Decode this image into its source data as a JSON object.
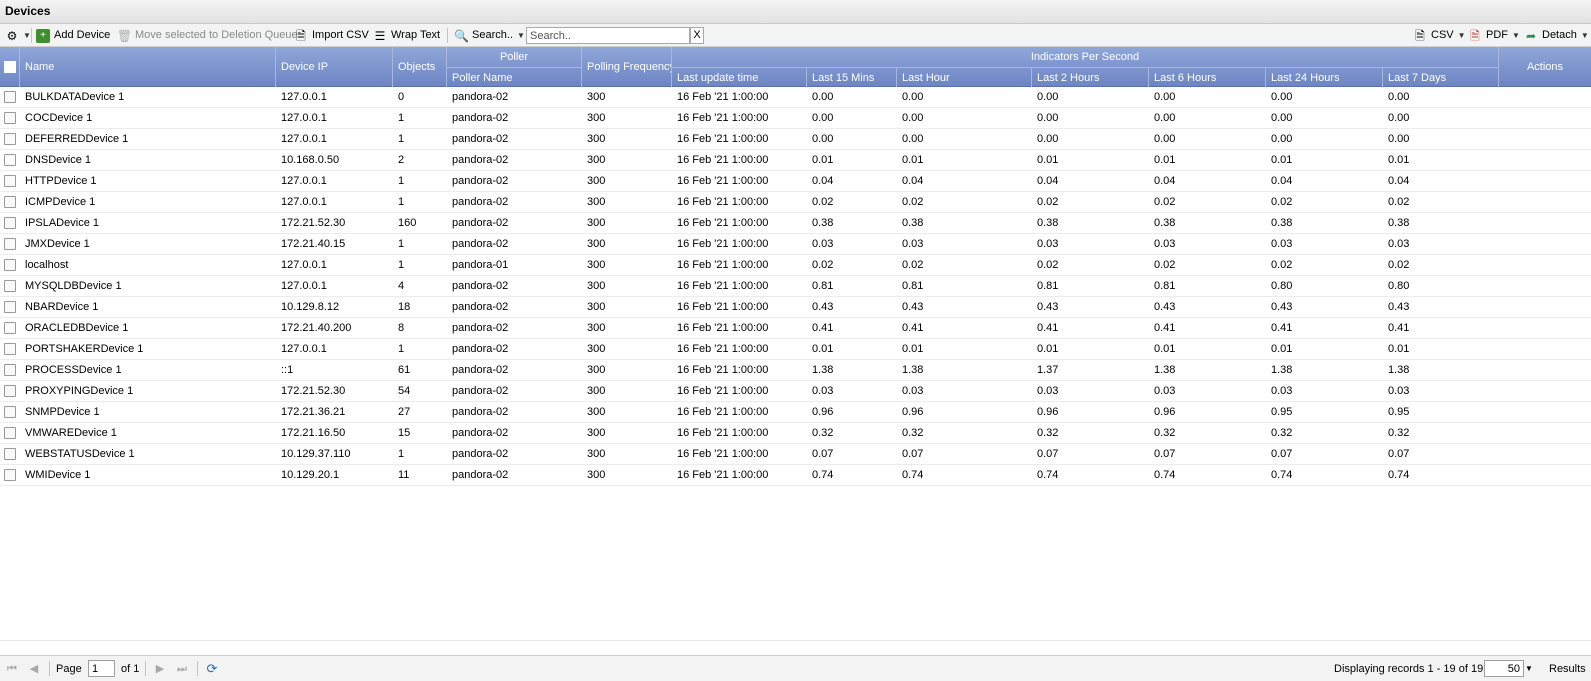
{
  "window": {
    "title": "Devices"
  },
  "toolbar": {
    "settings_icon": "gear-icon",
    "add_device": "Add Device",
    "move_to_deletion": "Move selected to Deletion Queue",
    "import_csv": "Import CSV",
    "wrap_text": "Wrap Text",
    "search_menu": "Search..",
    "search_placeholder": "Search..",
    "search_clear": "X",
    "csv": "CSV",
    "pdf": "PDF",
    "detach": "Detach"
  },
  "columns": {
    "name": "Name",
    "device_ip": "Device IP",
    "objects": "Objects",
    "poller_group": "Poller",
    "poller_name": "Poller Name",
    "polling_frequency": "Polling Frequency",
    "ips_group": "Indicators Per Second",
    "last_update": "Last update time",
    "last_15": "Last 15 Mins",
    "last_hour": "Last Hour",
    "last_2h": "Last 2 Hours",
    "last_6h": "Last 6 Hours",
    "last_24h": "Last 24 Hours",
    "last_7d": "Last 7 Days",
    "actions": "Actions"
  },
  "rows": [
    [
      "BULKDATADevice 1",
      "127.0.0.1",
      "0",
      "pandora-02",
      "300",
      "16 Feb '21 1:00:00",
      "0.00",
      "0.00",
      "0.00",
      "0.00",
      "0.00",
      "0.00"
    ],
    [
      "COCDevice 1",
      "127.0.0.1",
      "1",
      "pandora-02",
      "300",
      "16 Feb '21 1:00:00",
      "0.00",
      "0.00",
      "0.00",
      "0.00",
      "0.00",
      "0.00"
    ],
    [
      "DEFERREDDevice 1",
      "127.0.0.1",
      "1",
      "pandora-02",
      "300",
      "16 Feb '21 1:00:00",
      "0.00",
      "0.00",
      "0.00",
      "0.00",
      "0.00",
      "0.00"
    ],
    [
      "DNSDevice 1",
      "10.168.0.50",
      "2",
      "pandora-02",
      "300",
      "16 Feb '21 1:00:00",
      "0.01",
      "0.01",
      "0.01",
      "0.01",
      "0.01",
      "0.01"
    ],
    [
      "HTTPDevice 1",
      "127.0.0.1",
      "1",
      "pandora-02",
      "300",
      "16 Feb '21 1:00:00",
      "0.04",
      "0.04",
      "0.04",
      "0.04",
      "0.04",
      "0.04"
    ],
    [
      "ICMPDevice 1",
      "127.0.0.1",
      "1",
      "pandora-02",
      "300",
      "16 Feb '21 1:00:00",
      "0.02",
      "0.02",
      "0.02",
      "0.02",
      "0.02",
      "0.02"
    ],
    [
      "IPSLADevice 1",
      "172.21.52.30",
      "160",
      "pandora-02",
      "300",
      "16 Feb '21 1:00:00",
      "0.38",
      "0.38",
      "0.38",
      "0.38",
      "0.38",
      "0.38"
    ],
    [
      "JMXDevice 1",
      "172.21.40.15",
      "1",
      "pandora-02",
      "300",
      "16 Feb '21 1:00:00",
      "0.03",
      "0.03",
      "0.03",
      "0.03",
      "0.03",
      "0.03"
    ],
    [
      "localhost",
      "127.0.0.1",
      "1",
      "pandora-01",
      "300",
      "16 Feb '21 1:00:00",
      "0.02",
      "0.02",
      "0.02",
      "0.02",
      "0.02",
      "0.02"
    ],
    [
      "MYSQLDBDevice 1",
      "127.0.0.1",
      "4",
      "pandora-02",
      "300",
      "16 Feb '21 1:00:00",
      "0.81",
      "0.81",
      "0.81",
      "0.81",
      "0.80",
      "0.80"
    ],
    [
      "NBARDevice 1",
      "10.129.8.12",
      "18",
      "pandora-02",
      "300",
      "16 Feb '21 1:00:00",
      "0.43",
      "0.43",
      "0.43",
      "0.43",
      "0.43",
      "0.43"
    ],
    [
      "ORACLEDBDevice 1",
      "172.21.40.200",
      "8",
      "pandora-02",
      "300",
      "16 Feb '21 1:00:00",
      "0.41",
      "0.41",
      "0.41",
      "0.41",
      "0.41",
      "0.41"
    ],
    [
      "PORTSHAKERDevice 1",
      "127.0.0.1",
      "1",
      "pandora-02",
      "300",
      "16 Feb '21 1:00:00",
      "0.01",
      "0.01",
      "0.01",
      "0.01",
      "0.01",
      "0.01"
    ],
    [
      "PROCESSDevice 1",
      "::1",
      "61",
      "pandora-02",
      "300",
      "16 Feb '21 1:00:00",
      "1.38",
      "1.38",
      "1.37",
      "1.38",
      "1.38",
      "1.38"
    ],
    [
      "PROXYPINGDevice 1",
      "172.21.52.30",
      "54",
      "pandora-02",
      "300",
      "16 Feb '21 1:00:00",
      "0.03",
      "0.03",
      "0.03",
      "0.03",
      "0.03",
      "0.03"
    ],
    [
      "SNMPDevice 1",
      "172.21.36.21",
      "27",
      "pandora-02",
      "300",
      "16 Feb '21 1:00:00",
      "0.96",
      "0.96",
      "0.96",
      "0.96",
      "0.95",
      "0.95"
    ],
    [
      "VMWAREDevice 1",
      "172.21.16.50",
      "15",
      "pandora-02",
      "300",
      "16 Feb '21 1:00:00",
      "0.32",
      "0.32",
      "0.32",
      "0.32",
      "0.32",
      "0.32"
    ],
    [
      "WEBSTATUSDevice 1",
      "10.129.37.110",
      "1",
      "pandora-02",
      "300",
      "16 Feb '21 1:00:00",
      "0.07",
      "0.07",
      "0.07",
      "0.07",
      "0.07",
      "0.07"
    ],
    [
      "WMIDevice 1",
      "10.129.20.1",
      "11",
      "pandora-02",
      "300",
      "16 Feb '21 1:00:00",
      "0.74",
      "0.74",
      "0.74",
      "0.74",
      "0.74",
      "0.74"
    ]
  ],
  "pager": {
    "page_label": "Page",
    "page_value": "1",
    "of_label": "of 1",
    "display_info": "Displaying records 1 - 19 of 19",
    "page_size": "50",
    "results_label": "Results"
  }
}
